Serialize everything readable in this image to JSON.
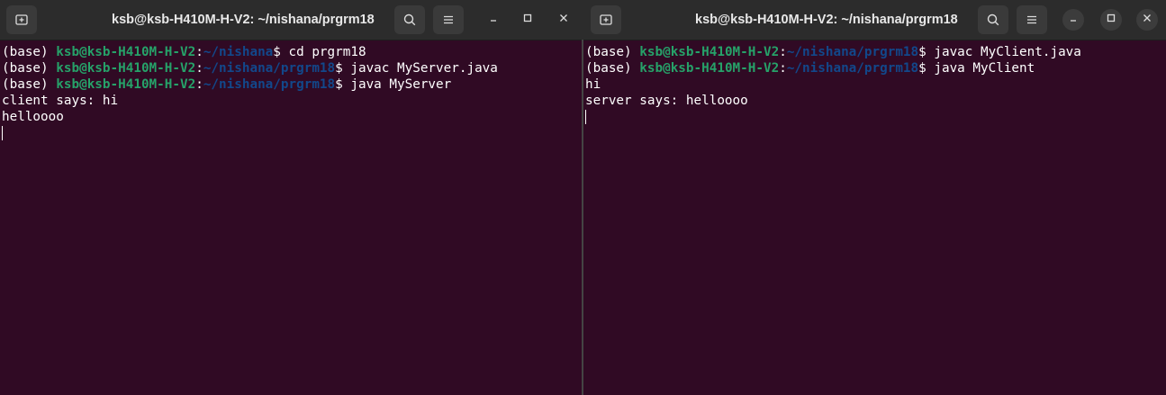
{
  "left": {
    "title": "ksb@ksb-H410M-H-V2: ~/nishana/prgrm18",
    "lines": [
      {
        "env": "(base) ",
        "user": "ksb@ksb-H410M-H-V2",
        "colon": ":",
        "path": "~/nishana",
        "tail": "$ cd prgrm18"
      },
      {
        "env": "(base) ",
        "user": "ksb@ksb-H410M-H-V2",
        "colon": ":",
        "path": "~/nishana/prgrm18",
        "tail": "$ javac MyServer.java"
      },
      {
        "env": "(base) ",
        "user": "ksb@ksb-H410M-H-V2",
        "colon": ":",
        "path": "~/nishana/prgrm18",
        "tail": "$ java MyServer"
      }
    ],
    "output": [
      "client says: hi",
      "helloooo"
    ]
  },
  "right": {
    "title": "ksb@ksb-H410M-H-V2: ~/nishana/prgrm18",
    "lines": [
      {
        "env": "(base) ",
        "user": "ksb@ksb-H410M-H-V2",
        "colon": ":",
        "path": "~/nishana/prgrm18",
        "tail": "$ javac MyClient.java"
      },
      {
        "env": "(base) ",
        "user": "ksb@ksb-H410M-H-V2",
        "colon": ":",
        "path": "~/nishana/prgrm18",
        "tail": "$ java MyClient"
      }
    ],
    "output": [
      "hi",
      "server says: helloooo"
    ]
  },
  "icons": {
    "new_tab": "new-tab-icon",
    "search": "search-icon",
    "menu": "hamburger-menu-icon",
    "minimize": "minimize-icon",
    "maximize": "maximize-icon",
    "close": "close-icon"
  },
  "colors": {
    "terminal_bg": "#300a24",
    "titlebar_bg": "#2c2c2c",
    "prompt_user": "#26a269",
    "prompt_path": "#12488b",
    "text": "#ffffff"
  }
}
